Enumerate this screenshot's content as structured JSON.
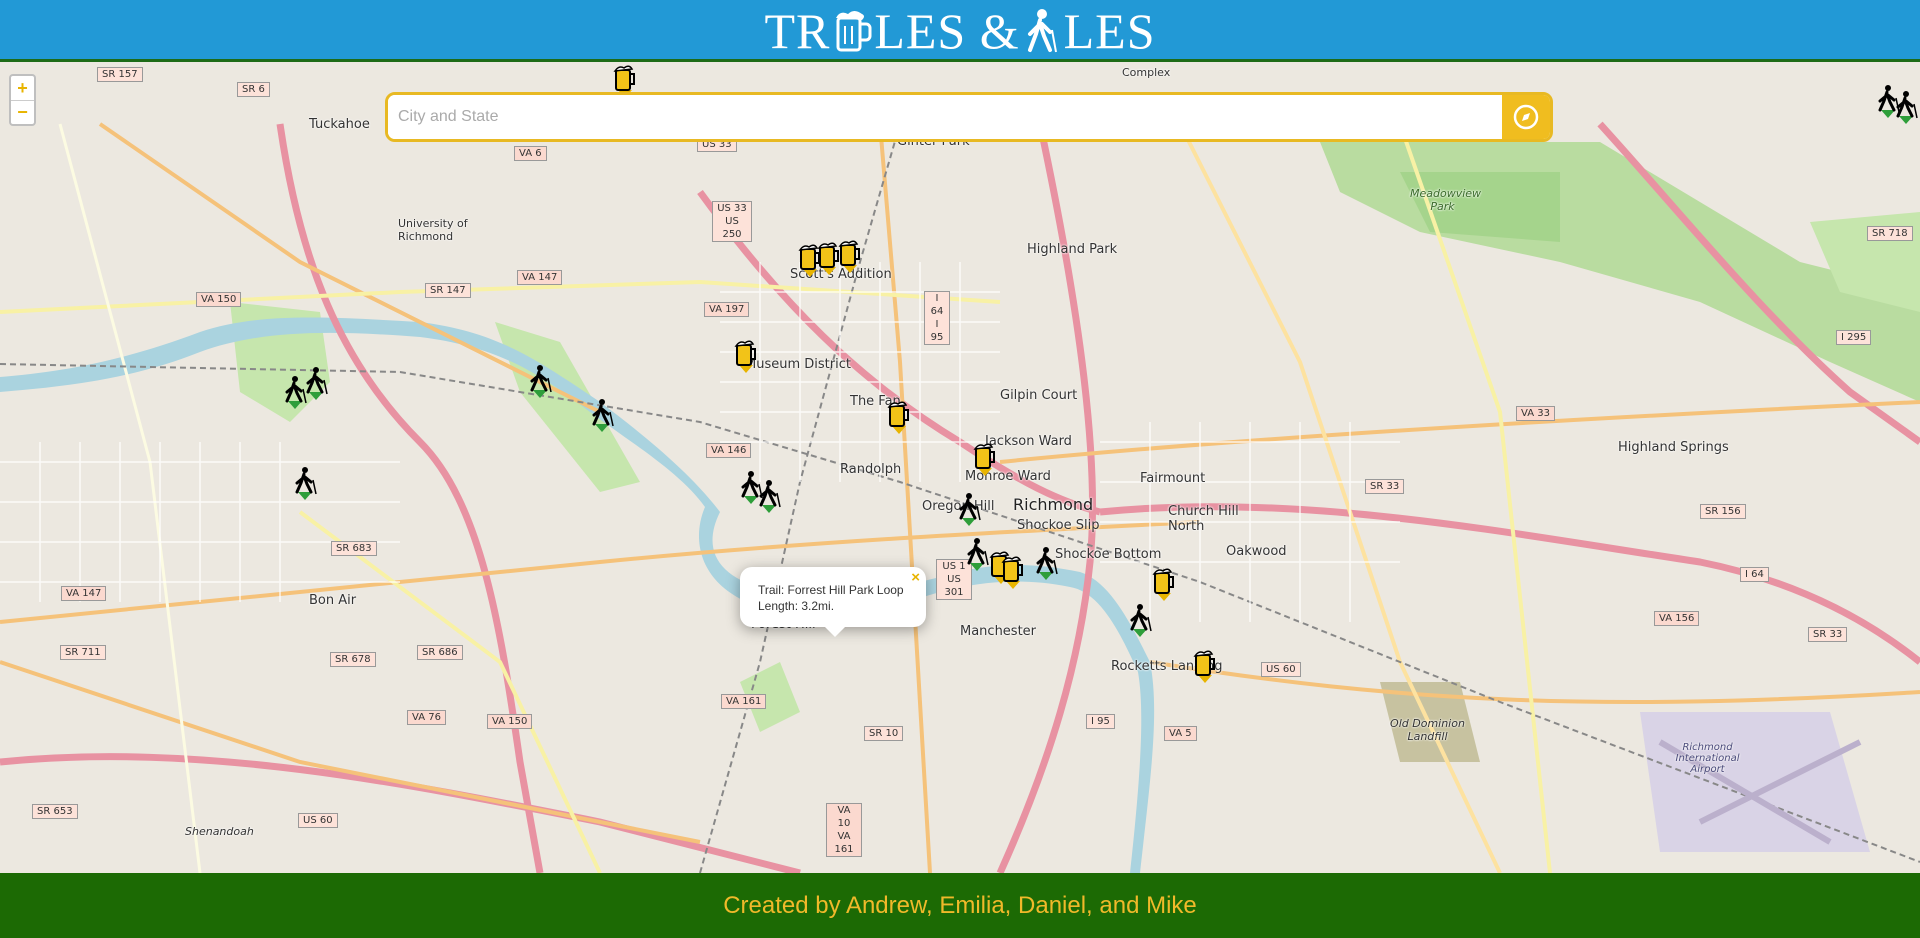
{
  "header": {
    "title_part1": "TR",
    "title_part2": "LES & ",
    "title_part3": "LES"
  },
  "search": {
    "placeholder": "City and State"
  },
  "zoom": {
    "in_label": "+",
    "out_label": "−"
  },
  "popup": {
    "line1": "Trail: Forrest Hill Park Loop",
    "line2": "Length: 3.2mi.",
    "close_label": "×"
  },
  "footer": {
    "credit": "Created by Andrew, Emilia, Daniel, and Mike"
  },
  "map": {
    "places": {
      "tuckahoe": "Tuckahoe",
      "university": "University of Richmond",
      "scott_addition": "Scott's Addition",
      "museum": "Museum District",
      "fan": "The Fan",
      "randolph": "Randolph",
      "monroe": "Monroe Ward",
      "jackson": "Jackson Ward",
      "gilpin": "Gilpin Court",
      "highland_park": "Highland Park",
      "richmond": "Richmond",
      "oregon_hill": "Oregon Hill",
      "shockoe_slip": "Shockoe Slip",
      "shockoe_bottom": "Shockoe Bottom",
      "fairmount": "Fairmount",
      "church_hill": "Church Hill North",
      "oakwood": "Oakwood",
      "highland_springs": "Highland Springs",
      "bon_air": "Bon Air",
      "forest_hill": "Forest Hill",
      "manchester": "Manchester",
      "rocketts": "Rocketts Landing",
      "ginter": "Ginter Park",
      "complex": "Complex",
      "old_dominion": "Old Dominion Landfill",
      "airport": "Richmond International Airport",
      "shenandoah": "Shenandoah",
      "meadowview": "Meadowview Park"
    },
    "shields": [
      "SR 157",
      "SR 6",
      "VA 150",
      "SR 147",
      "VA 147",
      "VA 197",
      "VA 6",
      "US 33 US 250",
      "I 64 I 95",
      "VA 146",
      "SR 683",
      "SR 678",
      "SR 686",
      "SR 711",
      "VA 76",
      "VA 150",
      "SR 653",
      "US 60",
      "VA 161",
      "SR 10",
      "VA 10 VA 161",
      "I 95",
      "VA 5",
      "US 60",
      "SR 33",
      "VA 33",
      "SR 156",
      "VA 156",
      "SR 33",
      "I 64",
      "I 295",
      "SR 718",
      "US 1 US 301",
      "VA 147",
      "US 33"
    ]
  },
  "colors": {
    "header": "#2299d6",
    "footer": "#1c6a04",
    "accent": "#f0b92a",
    "river": "#aad3df",
    "park": "#c8e8b0"
  }
}
